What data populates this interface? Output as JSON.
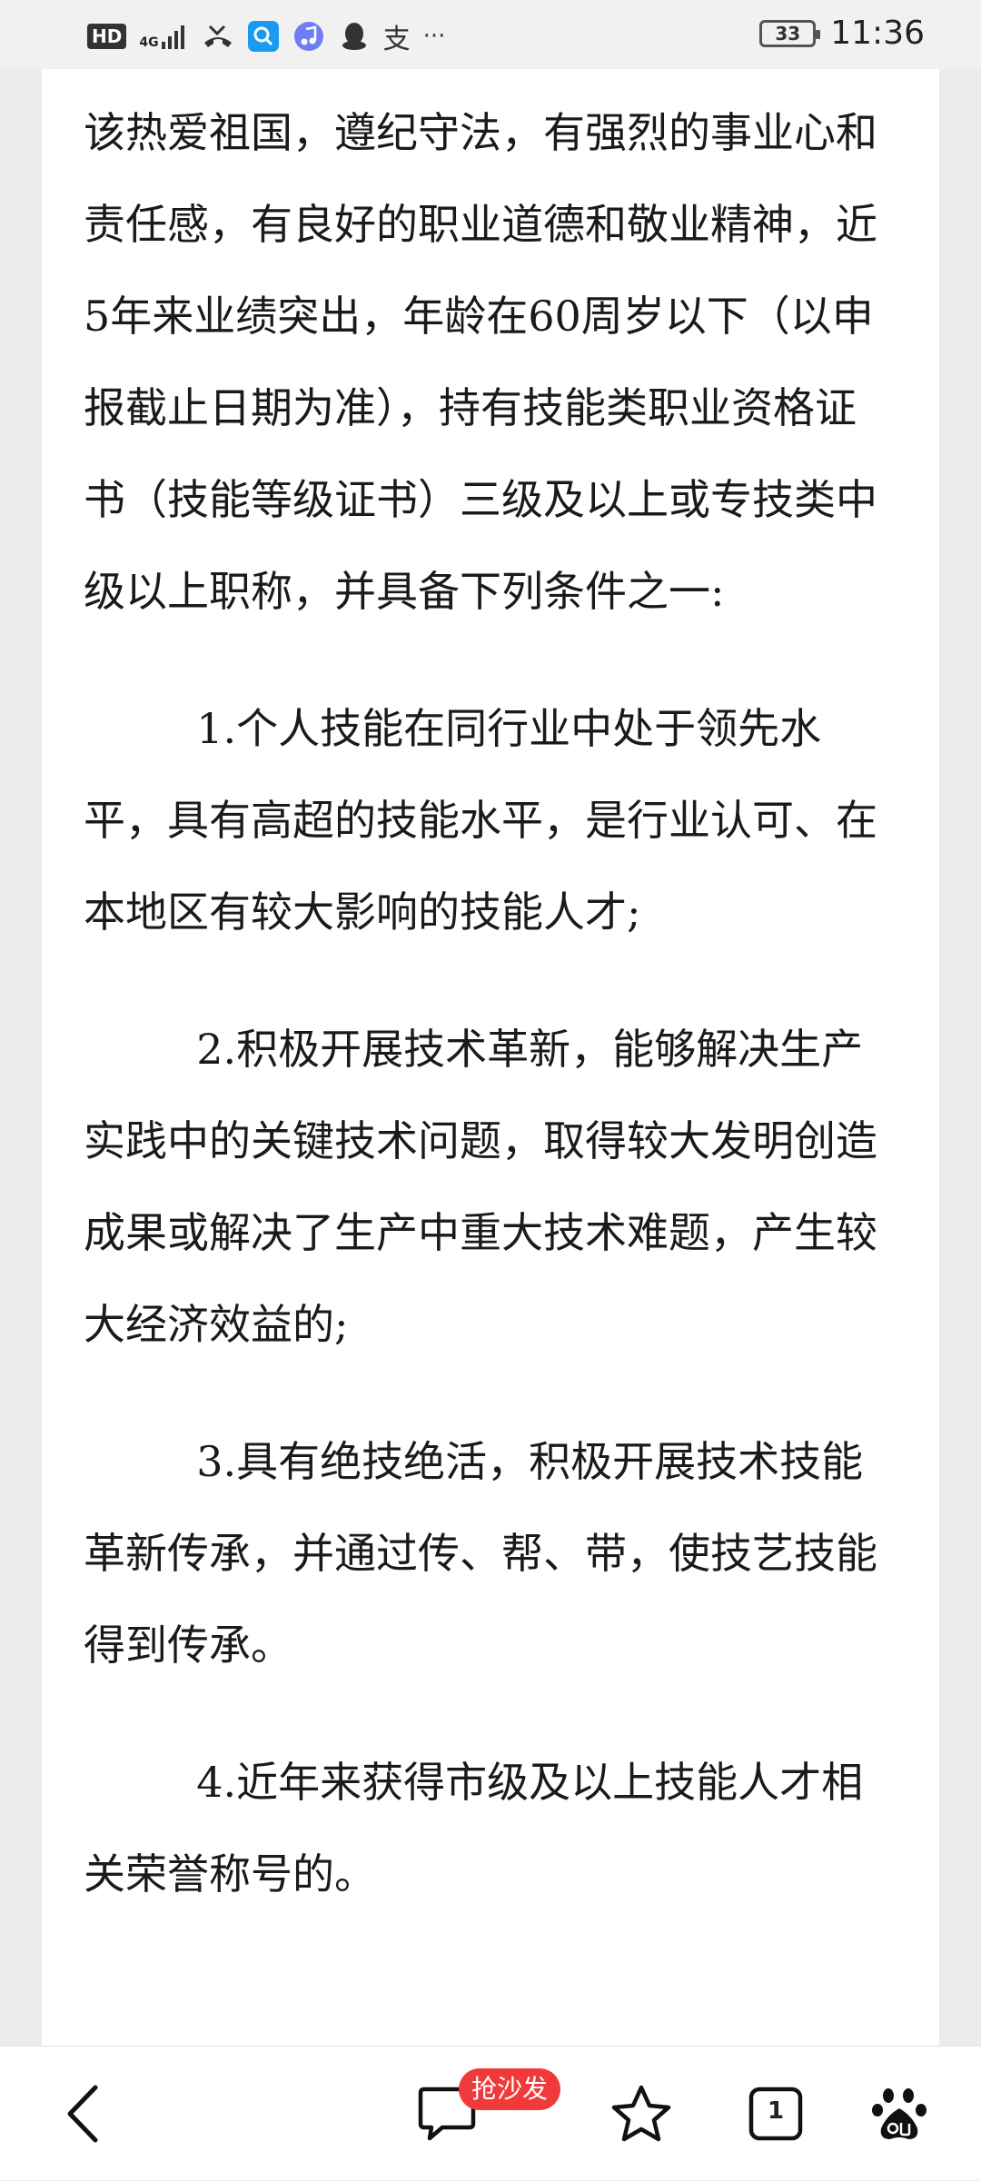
{
  "status_bar": {
    "hd": "HD",
    "network": "4G",
    "battery": "33",
    "time": "11:36",
    "more": "···",
    "app_glyph": "支"
  },
  "article": {
    "intro": "该热爱祖国，遵纪守法，有强烈的事业心和责任感，有良好的职业道德和敬业精神，近5年来业绩突出，年龄在60周岁以下（以申报截止日期为准），持有技能类职业资格证书（技能等级证书）三级及以上或专技类中级以上职称，并具备下列条件之一:",
    "items": [
      "1.个人技能在同行业中处于领先水平，具有高超的技能水平，是行业认可、在本地区有较大影响的技能人才;",
      "2.积极开展技术革新，能够解决生产实践中的关键技术问题，取得较大发明创造成果或解决了生产中重大技术难题，产生较大经济效益的;",
      "3.具有绝技绝活，积极开展技术技能革新传承，并通过传、帮、带，使技艺技能得到传承。",
      "4.近年来获得市级及以上技能人才相关荣誉称号的。"
    ]
  },
  "bottom_bar": {
    "comment_badge": "抢沙发",
    "tab_count": "1",
    "icons": [
      "back-icon",
      "comment-icon",
      "star-icon",
      "tabs-icon",
      "baidu-paw-icon"
    ]
  }
}
